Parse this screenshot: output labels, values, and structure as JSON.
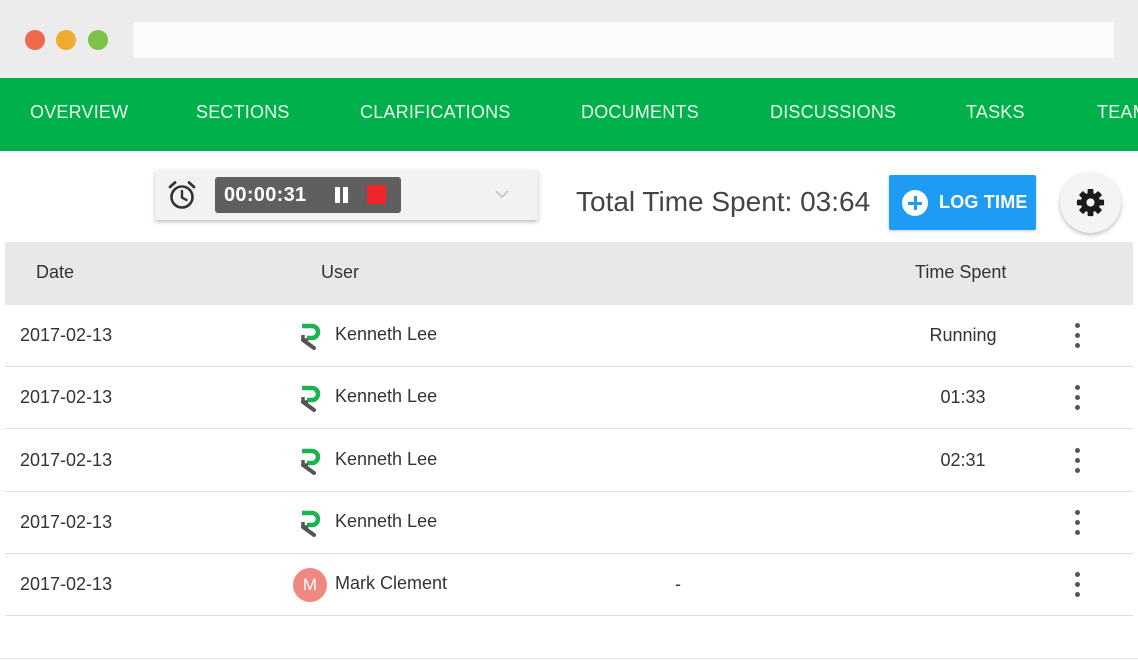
{
  "nav": {
    "items": [
      "OVERVIEW",
      "SECTIONS",
      "CLARIFICATIONS",
      "DOCUMENTS",
      "DISCUSSIONS",
      "TASKS",
      "TEAM"
    ]
  },
  "timer": {
    "time": "00:00:31",
    "icon": "alarm-clock-icon"
  },
  "total_time": "Total Time Spent: 03:64",
  "log_button": {
    "label": "LOG TIME",
    "icon": "plus-circle-icon"
  },
  "settings": {
    "icon": "gear-icon"
  },
  "table": {
    "headers": {
      "date": "Date",
      "user": "User",
      "time_spent": "Time Spent"
    },
    "rows": [
      {
        "date": "2017-02-13",
        "user": "Kenneth Lee",
        "avatar": "logo",
        "note": "",
        "time_spent": "Running"
      },
      {
        "date": "2017-02-13",
        "user": "Kenneth Lee",
        "avatar": "logo",
        "note": "",
        "time_spent": "01:33"
      },
      {
        "date": "2017-02-13",
        "user": "Kenneth Lee",
        "avatar": "logo",
        "note": "",
        "time_spent": "02:31"
      },
      {
        "date": "2017-02-13",
        "user": "Kenneth Lee",
        "avatar": "logo",
        "note": "",
        "time_spent": ""
      },
      {
        "date": "2017-02-13",
        "user": "Mark Clement",
        "avatar": "M",
        "note": "-",
        "time_spent": ""
      }
    ]
  },
  "colors": {
    "nav_bg": "#00b04a",
    "log_button": "#1e9bf3",
    "stop": "#f0262a",
    "avatar_m": "#f08780"
  }
}
